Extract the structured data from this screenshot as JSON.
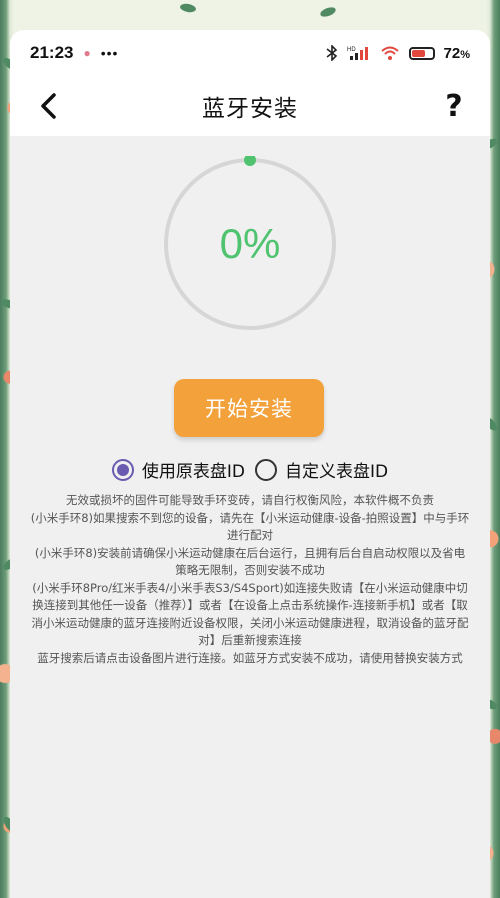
{
  "status_bar": {
    "time": "21:23",
    "indicators": "• ···",
    "icons": [
      "bluetooth-icon",
      "signal-icon",
      "wifi-icon",
      "battery-icon"
    ],
    "battery_percent": "72",
    "battery_unit": "%"
  },
  "nav": {
    "title": "蓝牙安装",
    "back_icon": "chevron-left-icon",
    "help_label": "?"
  },
  "progress": {
    "value": 0,
    "label": "0%",
    "accent_color": "#4fc36f"
  },
  "install_button": {
    "label": "开始安装",
    "color": "#f3a23b"
  },
  "dial_options": {
    "selected": "original",
    "options": [
      {
        "key": "original",
        "label": "使用原表盘ID"
      },
      {
        "key": "custom",
        "label": "自定义表盘ID"
      }
    ]
  },
  "notes": [
    "无效或损坏的固件可能导致手环变砖，请自行权衡风险，本软件概不负责",
    "(小米手环8)如果搜索不到您的设备，请先在【小米运动健康-设备-拍照设置】中与手环进行配对",
    "(小米手环8)安装前请确保小米运动健康在后台运行，且拥有后台自启动权限以及省电策略无限制，否则安装不成功",
    "(小米手环8Pro/红米手表4/小米手表S3/S4Sport)如连接失败请【在小米运动健康中切换连接到其他任一设备（推荐）】或者【在设备上点击系统操作-连接新手机】或者【取消小米运动健康的蓝牙连接附近设备权限，关闭小米运动健康进程，取消设备的蓝牙配对】后重新搜索连接",
    "蓝牙搜索后请点击设备图片进行连接。如蓝牙方式安装不成功，请使用替换安装方式"
  ]
}
